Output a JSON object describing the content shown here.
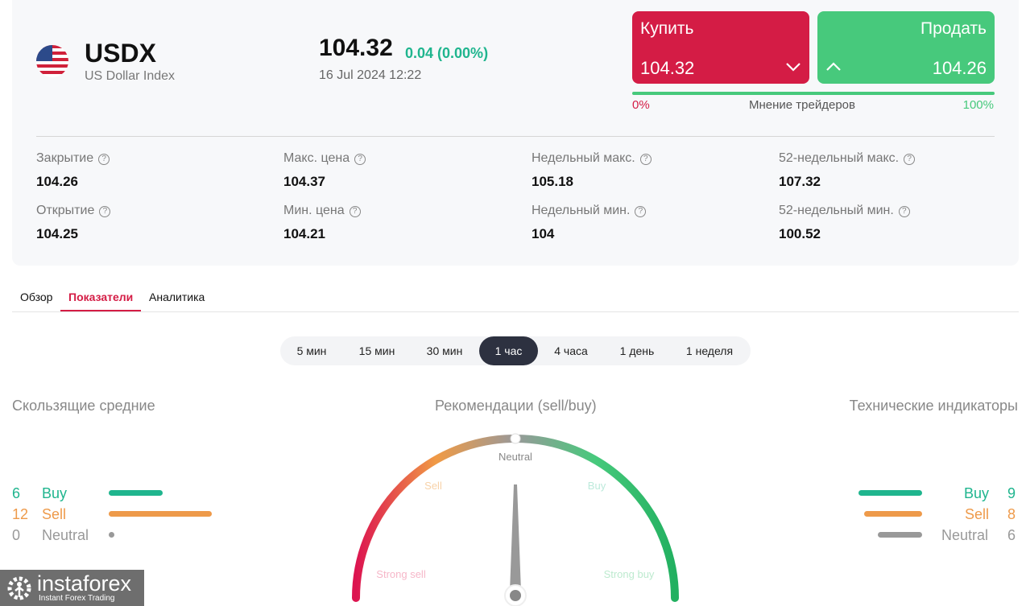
{
  "instrument": {
    "symbol": "USDX",
    "name": "US Dollar Index",
    "price": "104.32",
    "change": "0.04 (0.00%)",
    "datetime": "16 Jul 2024 12:22"
  },
  "trade": {
    "buy_label": "Купить",
    "buy_price": "104.32",
    "sell_label": "Продать",
    "sell_price": "104.26",
    "sentiment_label": "Мнение трейдеров",
    "sentiment_left": "0%",
    "sentiment_right": "100%",
    "sentiment_buy_fraction": 0.0
  },
  "stats": [
    {
      "label": "Закрытие",
      "value": "104.26"
    },
    {
      "label": "Макс. цена",
      "value": "104.37"
    },
    {
      "label": "Недельный макс.",
      "value": "105.18"
    },
    {
      "label": "52-недельный макс.",
      "value": "107.32"
    },
    {
      "label": "Открытие",
      "value": "104.25"
    },
    {
      "label": "Мин. цена",
      "value": "104.21"
    },
    {
      "label": "Недельный мин.",
      "value": "104"
    },
    {
      "label": "52-недельный мин.",
      "value": "100.52"
    }
  ],
  "tabs": [
    "Обзор",
    "Показатели",
    "Аналитика"
  ],
  "active_tab": "Показатели",
  "timeframes": [
    "5 мин",
    "15 мин",
    "30 мин",
    "1 час",
    "4 часа",
    "1 день",
    "1 неделя"
  ],
  "active_timeframe": "1 час",
  "moving_averages": {
    "title": "Скользящие средние",
    "buy": {
      "count": "6",
      "label": "Buy"
    },
    "sell": {
      "count": "12",
      "label": "Sell"
    },
    "neutral": {
      "count": "0",
      "label": "Neutral"
    }
  },
  "gauge": {
    "title": "Рекомендации (sell/buy)",
    "labels": {
      "strong_sell": "Strong sell",
      "sell": "Sell",
      "neutral": "Neutral",
      "buy": "Buy",
      "strong_buy": "Strong buy"
    },
    "value": "Neutral"
  },
  "technical": {
    "title": "Технические индикаторы",
    "buy": {
      "count": "9",
      "label": "Buy"
    },
    "sell": {
      "count": "8",
      "label": "Sell"
    },
    "neutral": {
      "count": "6",
      "label": "Neutral"
    }
  },
  "logo": {
    "name": "instaforex",
    "tagline": "Instant Forex Trading"
  },
  "colors": {
    "red": "#d41c45",
    "green": "#47c97c",
    "buy": "#1fb58e",
    "sell": "#ee9a4a",
    "neutral": "#999999"
  }
}
